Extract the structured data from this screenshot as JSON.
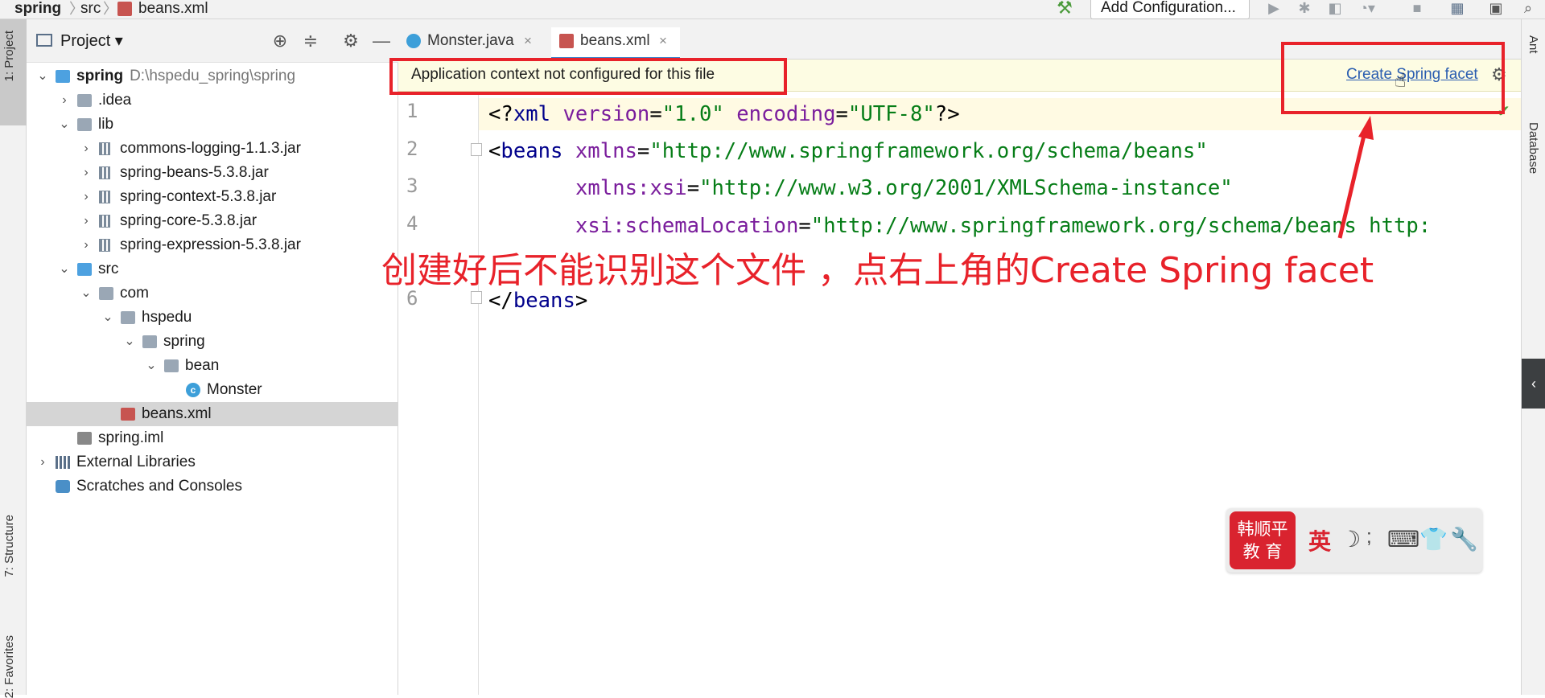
{
  "breadcrumb": {
    "project": "spring",
    "folder": "src",
    "file": "beans.xml"
  },
  "toolbar": {
    "run_config_label": "Add Configuration...",
    "icons": [
      "hammer-icon",
      "run-icon",
      "debug-icon",
      "coverage-icon",
      "profile-icon",
      "stop-icon",
      "project-structure-icon",
      "terminal-icon",
      "search-icon"
    ]
  },
  "left_strip": {
    "project_tab": "1: Project",
    "structure_tab": "7: Structure",
    "favorites_tab": "2: Favorites"
  },
  "project_panel": {
    "title": "Project",
    "tree": [
      {
        "label": "spring",
        "path": "D:\\hspedu_spring\\spring",
        "icon": "module-folder-icon",
        "chevron": "down"
      },
      {
        "label": ".idea",
        "icon": "folder-icon",
        "chevron": "right"
      },
      {
        "label": "lib",
        "icon": "folder-icon",
        "chevron": "down"
      },
      {
        "label": "commons-logging-1.1.3.jar",
        "icon": "jar-icon",
        "chevron": "right"
      },
      {
        "label": "spring-beans-5.3.8.jar",
        "icon": "jar-icon",
        "chevron": "right"
      },
      {
        "label": "spring-context-5.3.8.jar",
        "icon": "jar-icon",
        "chevron": "right"
      },
      {
        "label": "spring-core-5.3.8.jar",
        "icon": "jar-icon",
        "chevron": "right"
      },
      {
        "label": "spring-expression-5.3.8.jar",
        "icon": "jar-icon",
        "chevron": "right"
      },
      {
        "label": "src",
        "icon": "source-folder-icon",
        "chevron": "down"
      },
      {
        "label": "com",
        "icon": "package-icon",
        "chevron": "down"
      },
      {
        "label": "hspedu",
        "icon": "package-icon",
        "chevron": "down"
      },
      {
        "label": "spring",
        "icon": "package-icon",
        "chevron": "down"
      },
      {
        "label": "bean",
        "icon": "package-icon",
        "chevron": "down"
      },
      {
        "label": "Monster",
        "icon": "class-icon",
        "chevron": ""
      },
      {
        "label": "beans.xml",
        "icon": "xml-file-icon",
        "chevron": "",
        "selected": true
      },
      {
        "label": "spring.iml",
        "icon": "iml-file-icon",
        "chevron": ""
      },
      {
        "label": "External Libraries",
        "icon": "libraries-icon",
        "chevron": "right"
      },
      {
        "label": "Scratches and Consoles",
        "icon": "scratches-icon",
        "chevron": ""
      }
    ]
  },
  "editor": {
    "tabs": [
      {
        "label": "Monster.java",
        "icon": "class-icon",
        "active": false
      },
      {
        "label": "beans.xml",
        "icon": "xml-file-icon",
        "active": true
      }
    ],
    "notice": {
      "text": "Application context not configured for this file",
      "link": "Create Spring facet"
    },
    "line_numbers": [
      "1",
      "2",
      "3",
      "4",
      "6"
    ],
    "code": {
      "l1": {
        "open": "<?",
        "tag": "xml",
        "a1": " version",
        "eq1": "=",
        "v1": "\"1.0\"",
        "a2": " encoding",
        "eq2": "=",
        "v2": "\"UTF-8\"",
        "close": "?>"
      },
      "l2": {
        "open": "<",
        "tag": "beans",
        "a1": " xmlns",
        "eq1": "=",
        "v1": "\"http://www.springframework.org/schema/beans\""
      },
      "l3": {
        "a1": "xmlns:xsi",
        "eq1": "=",
        "v1": "\"http://www.w3.org/2001/XMLSchema-instance\""
      },
      "l4": {
        "a1": "xsi:schemaLocation",
        "eq1": "=",
        "v1": "\"http://www.springframework.org/schema/beans http:"
      },
      "l6": {
        "open": "</",
        "tag": "beans",
        "close": ">"
      }
    }
  },
  "right_strip": {
    "ant_tab": "Ant",
    "database_tab": "Database"
  },
  "annotation": {
    "text": "创建好后不能识别这个文件 ，点右上角的Create Spring facet",
    "color": "#e8222a"
  },
  "ime": {
    "logo_line1": "韩顺平",
    "logo_line2": "教 育",
    "lang": "英"
  }
}
